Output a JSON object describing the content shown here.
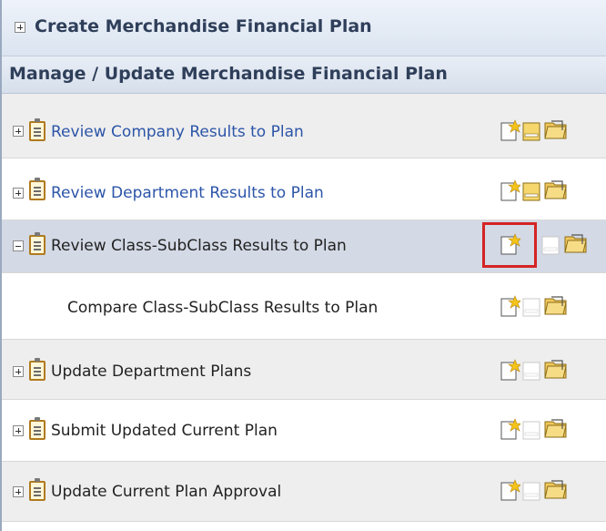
{
  "sections": {
    "create": {
      "label": "Create Merchandise Financial Plan",
      "expanded": false
    },
    "manage": {
      "label": "Manage / Update Merchandise Financial Plan"
    }
  },
  "rows": [
    {
      "label": "Review Company Results to Plan",
      "expanded": false,
      "link": true,
      "open_enabled": true
    },
    {
      "label": "Review Department Results to Plan",
      "expanded": false,
      "link": true,
      "open_enabled": true
    },
    {
      "label": "Review Class-SubClass Results to Plan",
      "expanded": true,
      "link": false,
      "open_enabled": false,
      "selected": true
    },
    {
      "label": "Compare Class-SubClass Results to Plan",
      "child": true,
      "open_enabled": false
    },
    {
      "label": "Update Department Plans",
      "expanded": false,
      "open_enabled": false
    },
    {
      "label": "Submit Updated Current Plan",
      "expanded": false,
      "open_enabled": false
    },
    {
      "label": "Update Current Plan Approval",
      "expanded": false,
      "open_enabled": false
    }
  ],
  "highlighted_action": "new-workbook-icon on row 3",
  "colors": {
    "link": "#2c55a8",
    "highlight": "#d42424",
    "selected_row": "#d3d9e5"
  }
}
